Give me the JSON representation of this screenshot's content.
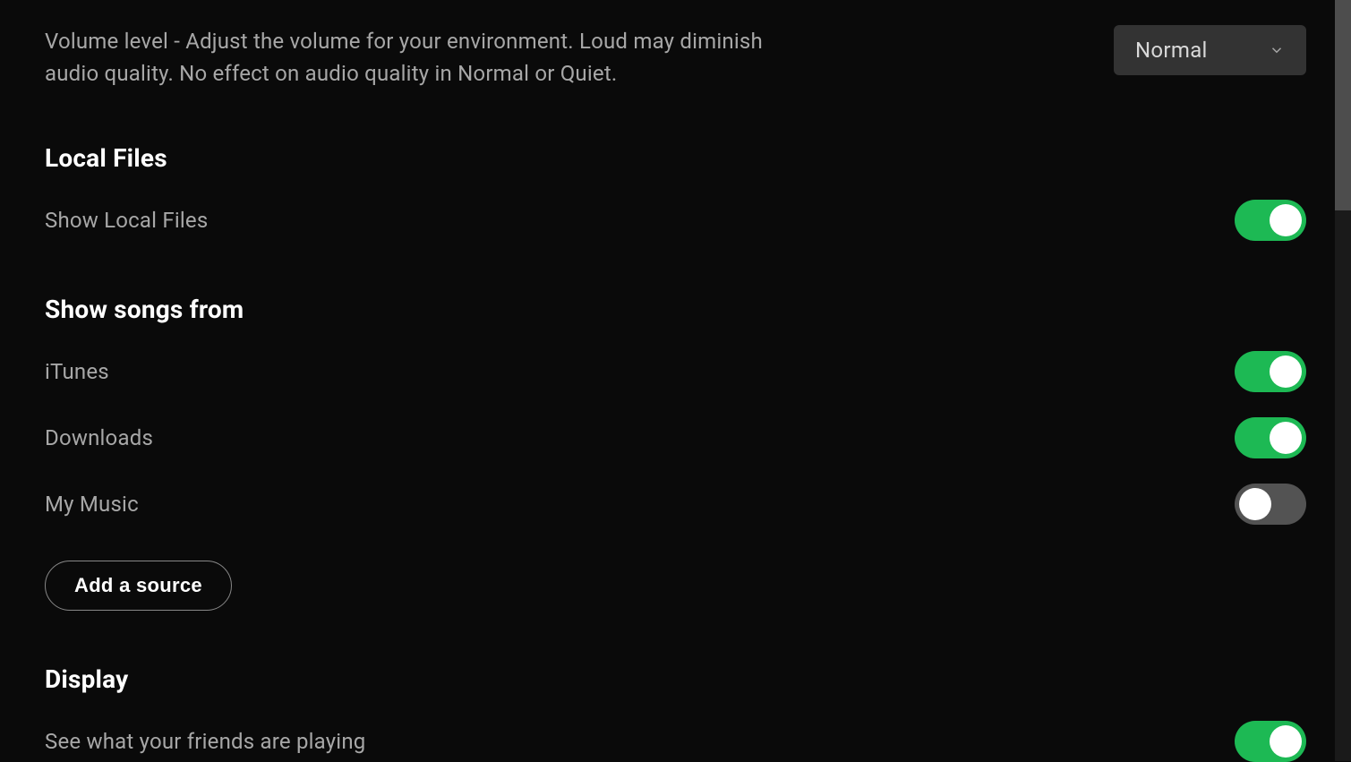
{
  "volume": {
    "description": "Volume level - Adjust the volume for your environment. Loud may diminish audio quality. No effect on audio quality in Normal or Quiet.",
    "selected": "Normal"
  },
  "local_files": {
    "heading": "Local Files",
    "show_label": "Show Local Files",
    "show_enabled": true
  },
  "show_songs_from": {
    "heading": "Show songs from",
    "sources": [
      {
        "label": "iTunes",
        "enabled": true
      },
      {
        "label": "Downloads",
        "enabled": true
      },
      {
        "label": "My Music",
        "enabled": false
      }
    ],
    "add_source_label": "Add a source"
  },
  "display": {
    "heading": "Display",
    "friends_label": "See what your friends are playing",
    "friends_enabled": true
  }
}
